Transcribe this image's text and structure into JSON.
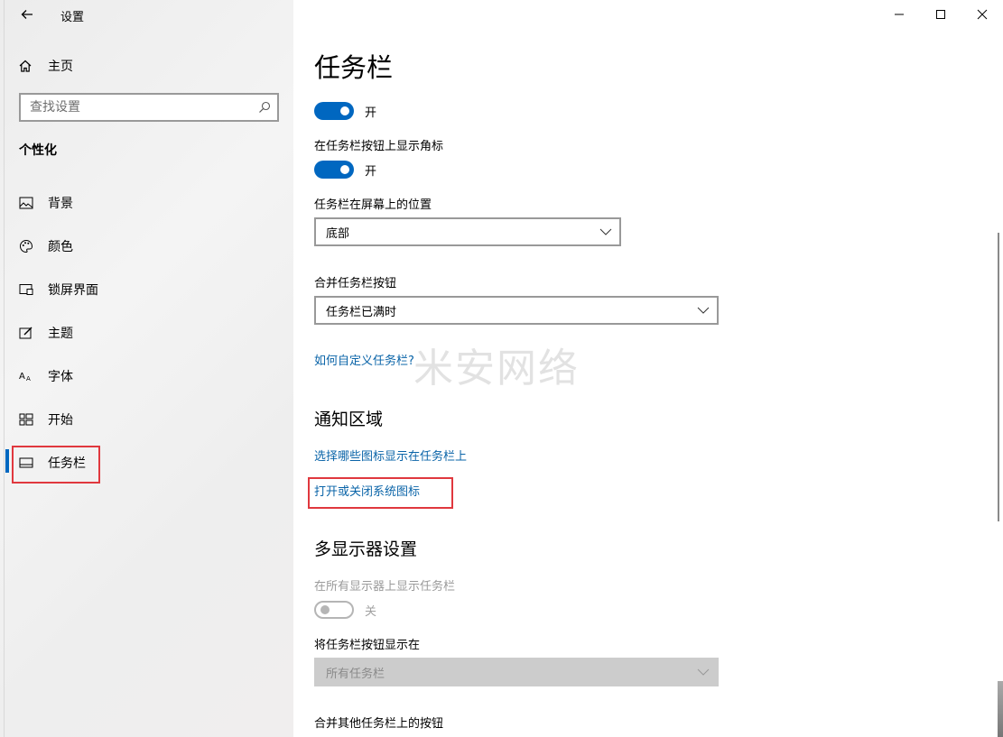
{
  "window": {
    "app_title": "设置",
    "controls": {
      "minimize": "minimize-icon",
      "maximize": "maximize-icon",
      "close": "close-icon"
    }
  },
  "sidebar": {
    "home_label": "主页",
    "search_placeholder": "查找设置",
    "section_title": "个性化",
    "items": [
      {
        "label": "背景",
        "icon": "picture-icon"
      },
      {
        "label": "颜色",
        "icon": "palette-icon"
      },
      {
        "label": "锁屏界面",
        "icon": "lock-screen-icon"
      },
      {
        "label": "主题",
        "icon": "theme-icon"
      },
      {
        "label": "字体",
        "icon": "font-icon"
      },
      {
        "label": "开始",
        "icon": "start-icon"
      },
      {
        "label": "任务栏",
        "icon": "taskbar-icon",
        "selected": true
      }
    ]
  },
  "main": {
    "title": "任务栏",
    "clipped_text": "",
    "powershell_toggle": {
      "state": "开",
      "on": true
    },
    "badge_setting": {
      "label": "在任务栏按钮上显示角标",
      "state": "开",
      "on": true
    },
    "position_setting": {
      "label": "任务栏在屏幕上的位置",
      "value": "底部"
    },
    "combine_setting": {
      "label": "合并任务栏按钮",
      "value": "任务栏已满时"
    },
    "help_link": "如何自定义任务栏?",
    "notification_area": {
      "title": "通知区域",
      "link_choose_icons": "选择哪些图标显示在任务栏上",
      "link_system_icons": "打开或关闭系统图标"
    },
    "multi_display": {
      "title": "多显示器设置",
      "show_all_label": "在所有显示器上显示任务栏",
      "show_all_state": "关",
      "show_all_on": false,
      "buttons_on_label": "将任务栏按钮显示在",
      "buttons_on_value": "所有任务栏",
      "combine_other_label": "合并其他任务栏上的按钮"
    }
  },
  "watermark": "米安网络",
  "colors": {
    "accent": "#0067c0",
    "link": "#0a64a8",
    "highlight_box": "#e0383e"
  }
}
